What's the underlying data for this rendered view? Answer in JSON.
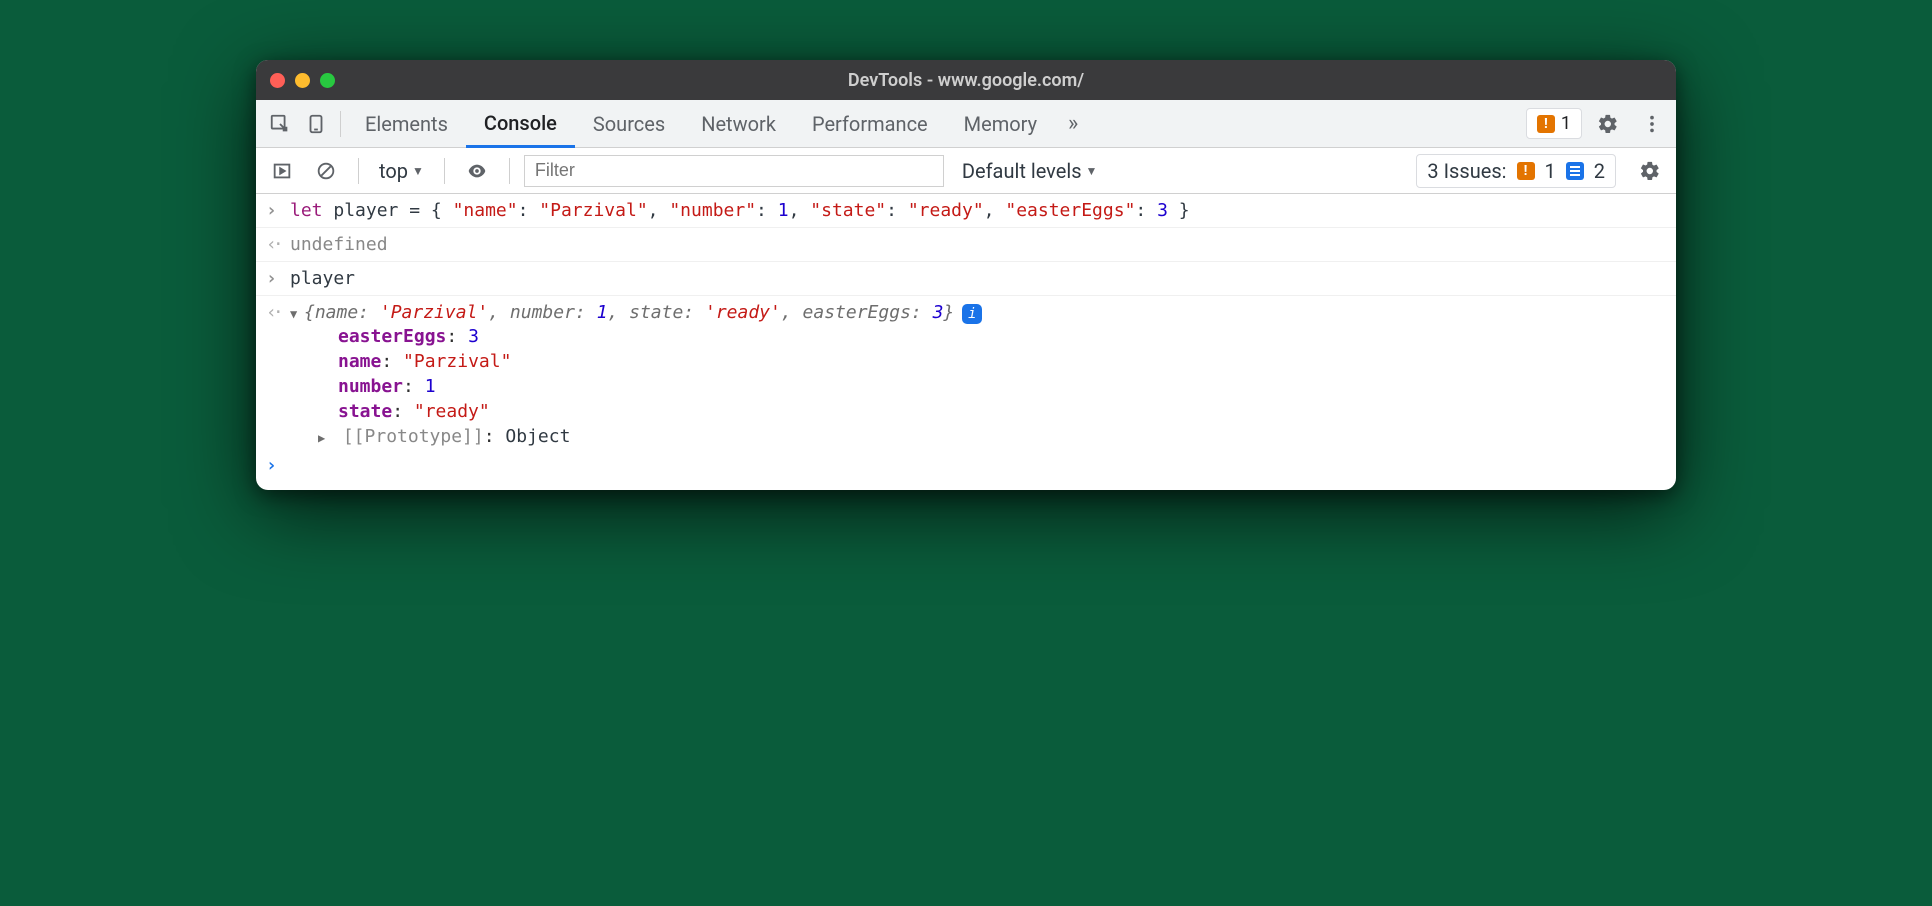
{
  "titlebar": {
    "title": "DevTools - www.google.com/"
  },
  "tabs": {
    "elements": "Elements",
    "console": "Console",
    "sources": "Sources",
    "network": "Network",
    "performance": "Performance",
    "memory": "Memory"
  },
  "toolbar": {
    "warn_count": "1"
  },
  "subbar": {
    "context": "top",
    "filter_placeholder": "Filter",
    "levels": "Default levels",
    "issues_label": "3 Issues:",
    "issues_warn": "1",
    "issues_info": "2"
  },
  "console": {
    "input1": "let player = { \"name\": \"Parzival\", \"number\": 1, \"state\": \"ready\", \"easterEggs\": 3 }",
    "output1": "undefined",
    "input2": "player",
    "summary": "{name: 'Parzival', number: 1, state: 'ready', easterEggs: 3}",
    "props": {
      "easterEggs_k": "easterEggs",
      "easterEggs_v": "3",
      "name_k": "name",
      "name_v": "\"Parzival\"",
      "number_k": "number",
      "number_v": "1",
      "state_k": "state",
      "state_v": "\"ready\""
    },
    "proto_k": "[[Prototype]]",
    "proto_v": "Object"
  }
}
